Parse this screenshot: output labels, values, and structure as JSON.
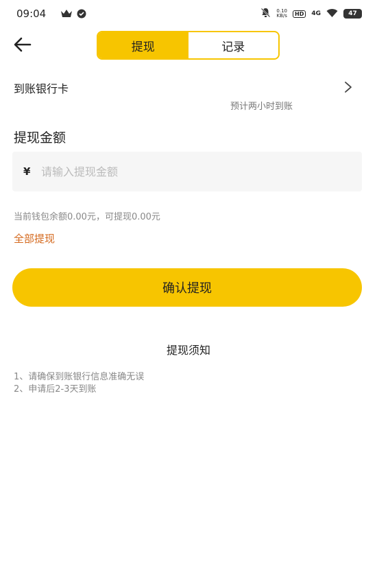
{
  "status_bar": {
    "time": "09:04",
    "net_speed_top": "0.10",
    "net_speed_bottom": "KB/s",
    "hd_label": "HD",
    "signal_label": "4G",
    "battery": "47",
    "icons": [
      "crown-icon",
      "shield-icon",
      "mute-bell-icon",
      "wifi-icon"
    ]
  },
  "header": {
    "tabs": [
      {
        "label": "提现",
        "active": true
      },
      {
        "label": "记录",
        "active": false
      }
    ]
  },
  "bank": {
    "label": "到账银行卡",
    "note": "预计两小时到账"
  },
  "amount": {
    "title": "提现金额",
    "currency_symbol": "¥",
    "placeholder": "请输入提现金额",
    "value": ""
  },
  "balance_text": "当前钱包余额0.00元，可提现0.00元",
  "withdraw_all": "全部提现",
  "confirm_label": "确认提现",
  "notice": {
    "title": "提现须知",
    "items": [
      "1、请确保到账银行信息准确无误",
      "2、申请后2-3天到账"
    ]
  },
  "colors": {
    "accent": "#f7c500",
    "link": "#d4691e"
  }
}
